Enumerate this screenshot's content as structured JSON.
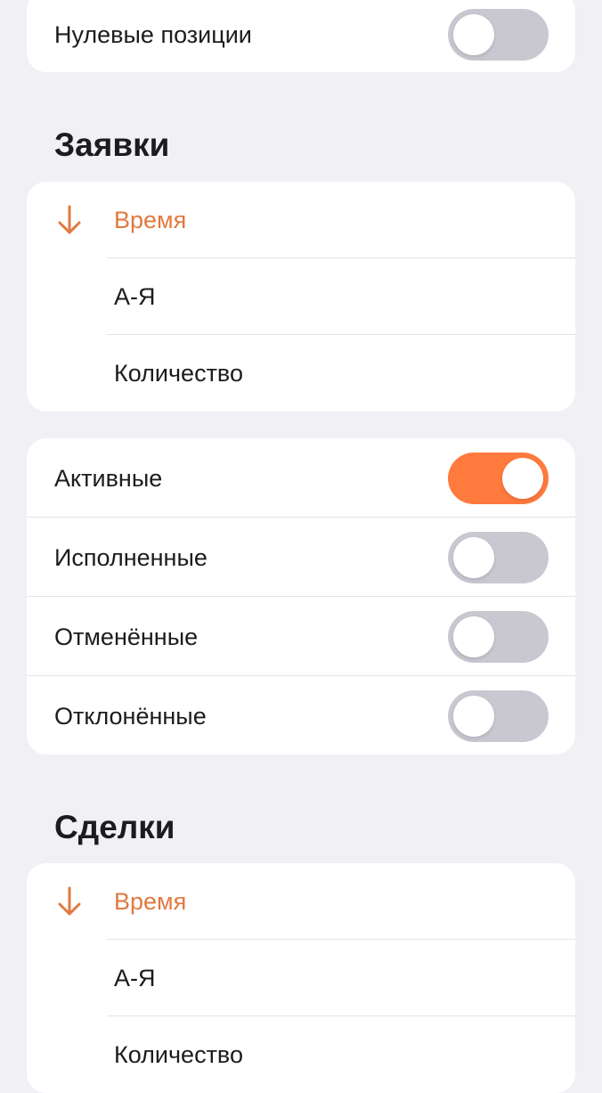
{
  "top_card": {
    "rows": [
      {
        "label": "Нулевые позиции",
        "on": false
      }
    ]
  },
  "orders": {
    "title": "Заявки",
    "sort_options": [
      "Время",
      "А-Я",
      "Количество"
    ],
    "active_sort": 0,
    "filters": [
      {
        "label": "Активные",
        "on": true
      },
      {
        "label": "Исполненные",
        "on": false
      },
      {
        "label": "Отменённые",
        "on": false
      },
      {
        "label": "Отклонённые",
        "on": false
      }
    ]
  },
  "deals": {
    "title": "Сделки",
    "sort_options": [
      "Время",
      "А-Я",
      "Количество"
    ],
    "active_sort": 0
  },
  "colors": {
    "accent": "#ff7a3d",
    "accent_text": "#e07a3f",
    "toggle_off": "#c9c8d1",
    "background": "#f0f0f5"
  },
  "icons": {
    "sort": "arrow-down-icon"
  }
}
